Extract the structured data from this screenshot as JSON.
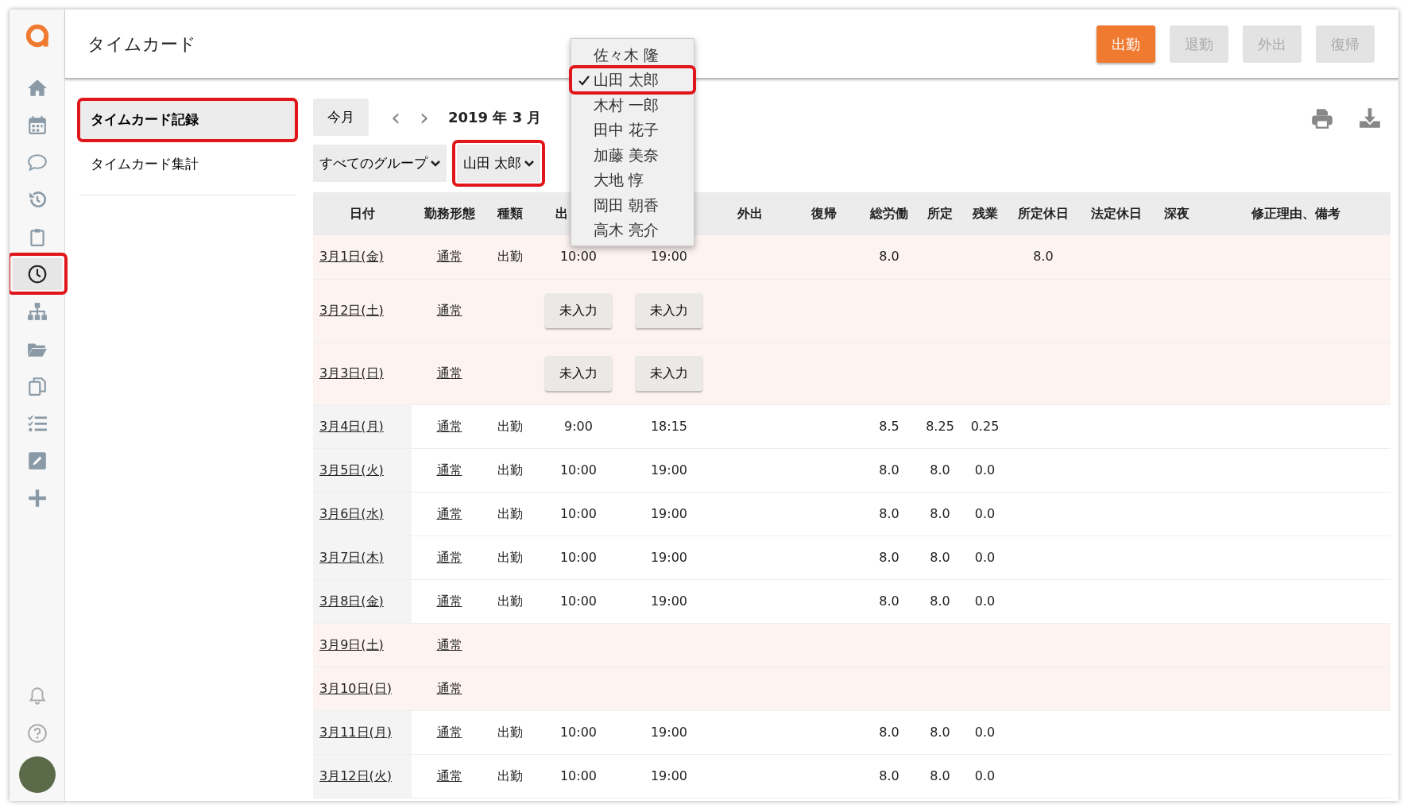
{
  "rail": [
    {
      "kind": "home",
      "selected": false,
      "annotated": false
    },
    {
      "kind": "calendar",
      "selected": false,
      "annotated": false
    },
    {
      "kind": "chat",
      "selected": false,
      "annotated": false
    },
    {
      "kind": "history",
      "selected": false,
      "annotated": false
    },
    {
      "kind": "clipboard",
      "selected": false,
      "annotated": false
    },
    {
      "kind": "clock",
      "selected": true,
      "annotated": true
    },
    {
      "kind": "sitemap",
      "selected": false,
      "annotated": false
    },
    {
      "kind": "folder",
      "selected": false,
      "annotated": false
    },
    {
      "kind": "copy",
      "selected": false,
      "annotated": false
    },
    {
      "kind": "tasks",
      "selected": false,
      "annotated": false
    },
    {
      "kind": "edit",
      "selected": false,
      "annotated": false
    },
    {
      "kind": "plus",
      "selected": false,
      "annotated": false
    }
  ],
  "rail_bottom": [
    {
      "kind": "bell"
    },
    {
      "kind": "help"
    },
    {
      "kind": "avatar"
    }
  ],
  "header": {
    "title": "タイムカード",
    "buttons": [
      {
        "label": "出勤",
        "disabled": false
      },
      {
        "label": "退勤",
        "disabled": true
      },
      {
        "label": "外出",
        "disabled": true
      },
      {
        "label": "復帰",
        "disabled": true
      }
    ]
  },
  "submenu": [
    {
      "label": "タイムカード記録",
      "selected": true,
      "annotated": true
    },
    {
      "label": "タイムカード集計",
      "selected": false,
      "annotated": false
    }
  ],
  "toolbar": {
    "today": "今月",
    "prev": "‹",
    "next": "›",
    "month": "2019 年 3 月",
    "group_select": "すべてのグループ",
    "user_select": "山田 太郎",
    "user_select_annotated": true
  },
  "user_dropdown": [
    {
      "label": "佐々木 隆",
      "selected": false,
      "annotated": false
    },
    {
      "label": "山田 太郎",
      "selected": true,
      "annotated": true
    },
    {
      "label": "木村 一郎",
      "selected": false,
      "annotated": false
    },
    {
      "label": "田中 花子",
      "selected": false,
      "annotated": false
    },
    {
      "label": "加藤 美奈",
      "selected": false,
      "annotated": false
    },
    {
      "label": "大地 惇",
      "selected": false,
      "annotated": false
    },
    {
      "label": "岡田 朝香",
      "selected": false,
      "annotated": false
    },
    {
      "label": "高木 亮介",
      "selected": false,
      "annotated": false
    }
  ],
  "table": {
    "columns": [
      {
        "label": "日付"
      },
      {
        "label": "勤務形態"
      },
      {
        "label": "種類"
      },
      {
        "label": "出"
      },
      {},
      {
        "label": "外出"
      },
      {
        "label": "復帰"
      },
      {
        "label": "総労働"
      },
      {
        "label": "所定"
      },
      {
        "label": "残業"
      },
      {
        "label": "所定休日"
      },
      {
        "label": "法定休日"
      },
      {
        "label": "深夜"
      },
      {
        "label": "修正理由、備考"
      }
    ],
    "rows": [
      {
        "date": "3月1日(金)",
        "pattern": "通常",
        "type": "出勤",
        "holiday": true,
        "in": {
          "kind": "text",
          "text": "10:00"
        },
        "out": {
          "kind": "text",
          "text": "19:00"
        },
        "total": "8.0",
        "fixed": "",
        "overtime": "",
        "fixed_holiday": "8.0"
      },
      {
        "date": "3月2日(土)",
        "pattern": "通常",
        "type": "",
        "holiday": true,
        "in": {
          "kind": "button",
          "text": "未入力"
        },
        "out": {
          "kind": "button",
          "text": "未入力"
        },
        "total": "",
        "fixed": "",
        "overtime": "",
        "fixed_holiday": ""
      },
      {
        "date": "3月3日(日)",
        "pattern": "通常",
        "type": "",
        "holiday": true,
        "in": {
          "kind": "button",
          "text": "未入力"
        },
        "out": {
          "kind": "button",
          "text": "未入力"
        },
        "total": "",
        "fixed": "",
        "overtime": "",
        "fixed_holiday": ""
      },
      {
        "date": "3月4日(月)",
        "pattern": "通常",
        "type": "出勤",
        "holiday": false,
        "in": {
          "kind": "text",
          "text": "9:00"
        },
        "out": {
          "kind": "text",
          "text": "18:15"
        },
        "total": "8.5",
        "fixed": "8.25",
        "overtime": "0.25",
        "fixed_holiday": ""
      },
      {
        "date": "3月5日(火)",
        "pattern": "通常",
        "type": "出勤",
        "holiday": false,
        "in": {
          "kind": "text",
          "text": "10:00"
        },
        "out": {
          "kind": "text",
          "text": "19:00"
        },
        "total": "8.0",
        "fixed": "8.0",
        "overtime": "0.0",
        "fixed_holiday": ""
      },
      {
        "date": "3月6日(水)",
        "pattern": "通常",
        "type": "出勤",
        "holiday": false,
        "in": {
          "kind": "text",
          "text": "10:00"
        },
        "out": {
          "kind": "text",
          "text": "19:00"
        },
        "total": "8.0",
        "fixed": "8.0",
        "overtime": "0.0",
        "fixed_holiday": ""
      },
      {
        "date": "3月7日(木)",
        "pattern": "通常",
        "type": "出勤",
        "holiday": false,
        "in": {
          "kind": "text",
          "text": "10:00"
        },
        "out": {
          "kind": "text",
          "text": "19:00"
        },
        "total": "8.0",
        "fixed": "8.0",
        "overtime": "0.0",
        "fixed_holiday": ""
      },
      {
        "date": "3月8日(金)",
        "pattern": "通常",
        "type": "出勤",
        "holiday": false,
        "in": {
          "kind": "text",
          "text": "10:00"
        },
        "out": {
          "kind": "text",
          "text": "19:00"
        },
        "total": "8.0",
        "fixed": "8.0",
        "overtime": "0.0",
        "fixed_holiday": ""
      },
      {
        "date": "3月9日(土)",
        "pattern": "通常",
        "type": "",
        "holiday": true,
        "total": "",
        "fixed": "",
        "overtime": "",
        "fixed_holiday": ""
      },
      {
        "date": "3月10日(日)",
        "pattern": "通常",
        "type": "",
        "holiday": true,
        "total": "",
        "fixed": "",
        "overtime": "",
        "fixed_holiday": ""
      },
      {
        "date": "3月11日(月)",
        "pattern": "通常",
        "type": "出勤",
        "holiday": false,
        "in": {
          "kind": "text",
          "text": "10:00"
        },
        "out": {
          "kind": "text",
          "text": "19:00"
        },
        "total": "8.0",
        "fixed": "8.0",
        "overtime": "0.0",
        "fixed_holiday": ""
      },
      {
        "date": "3月12日(火)",
        "pattern": "通常",
        "type": "出勤",
        "holiday": false,
        "in": {
          "kind": "text",
          "text": "10:00"
        },
        "out": {
          "kind": "text",
          "text": "19:00"
        },
        "total": "8.0",
        "fixed": "8.0",
        "overtime": "0.0",
        "fixed_holiday": ""
      }
    ]
  }
}
